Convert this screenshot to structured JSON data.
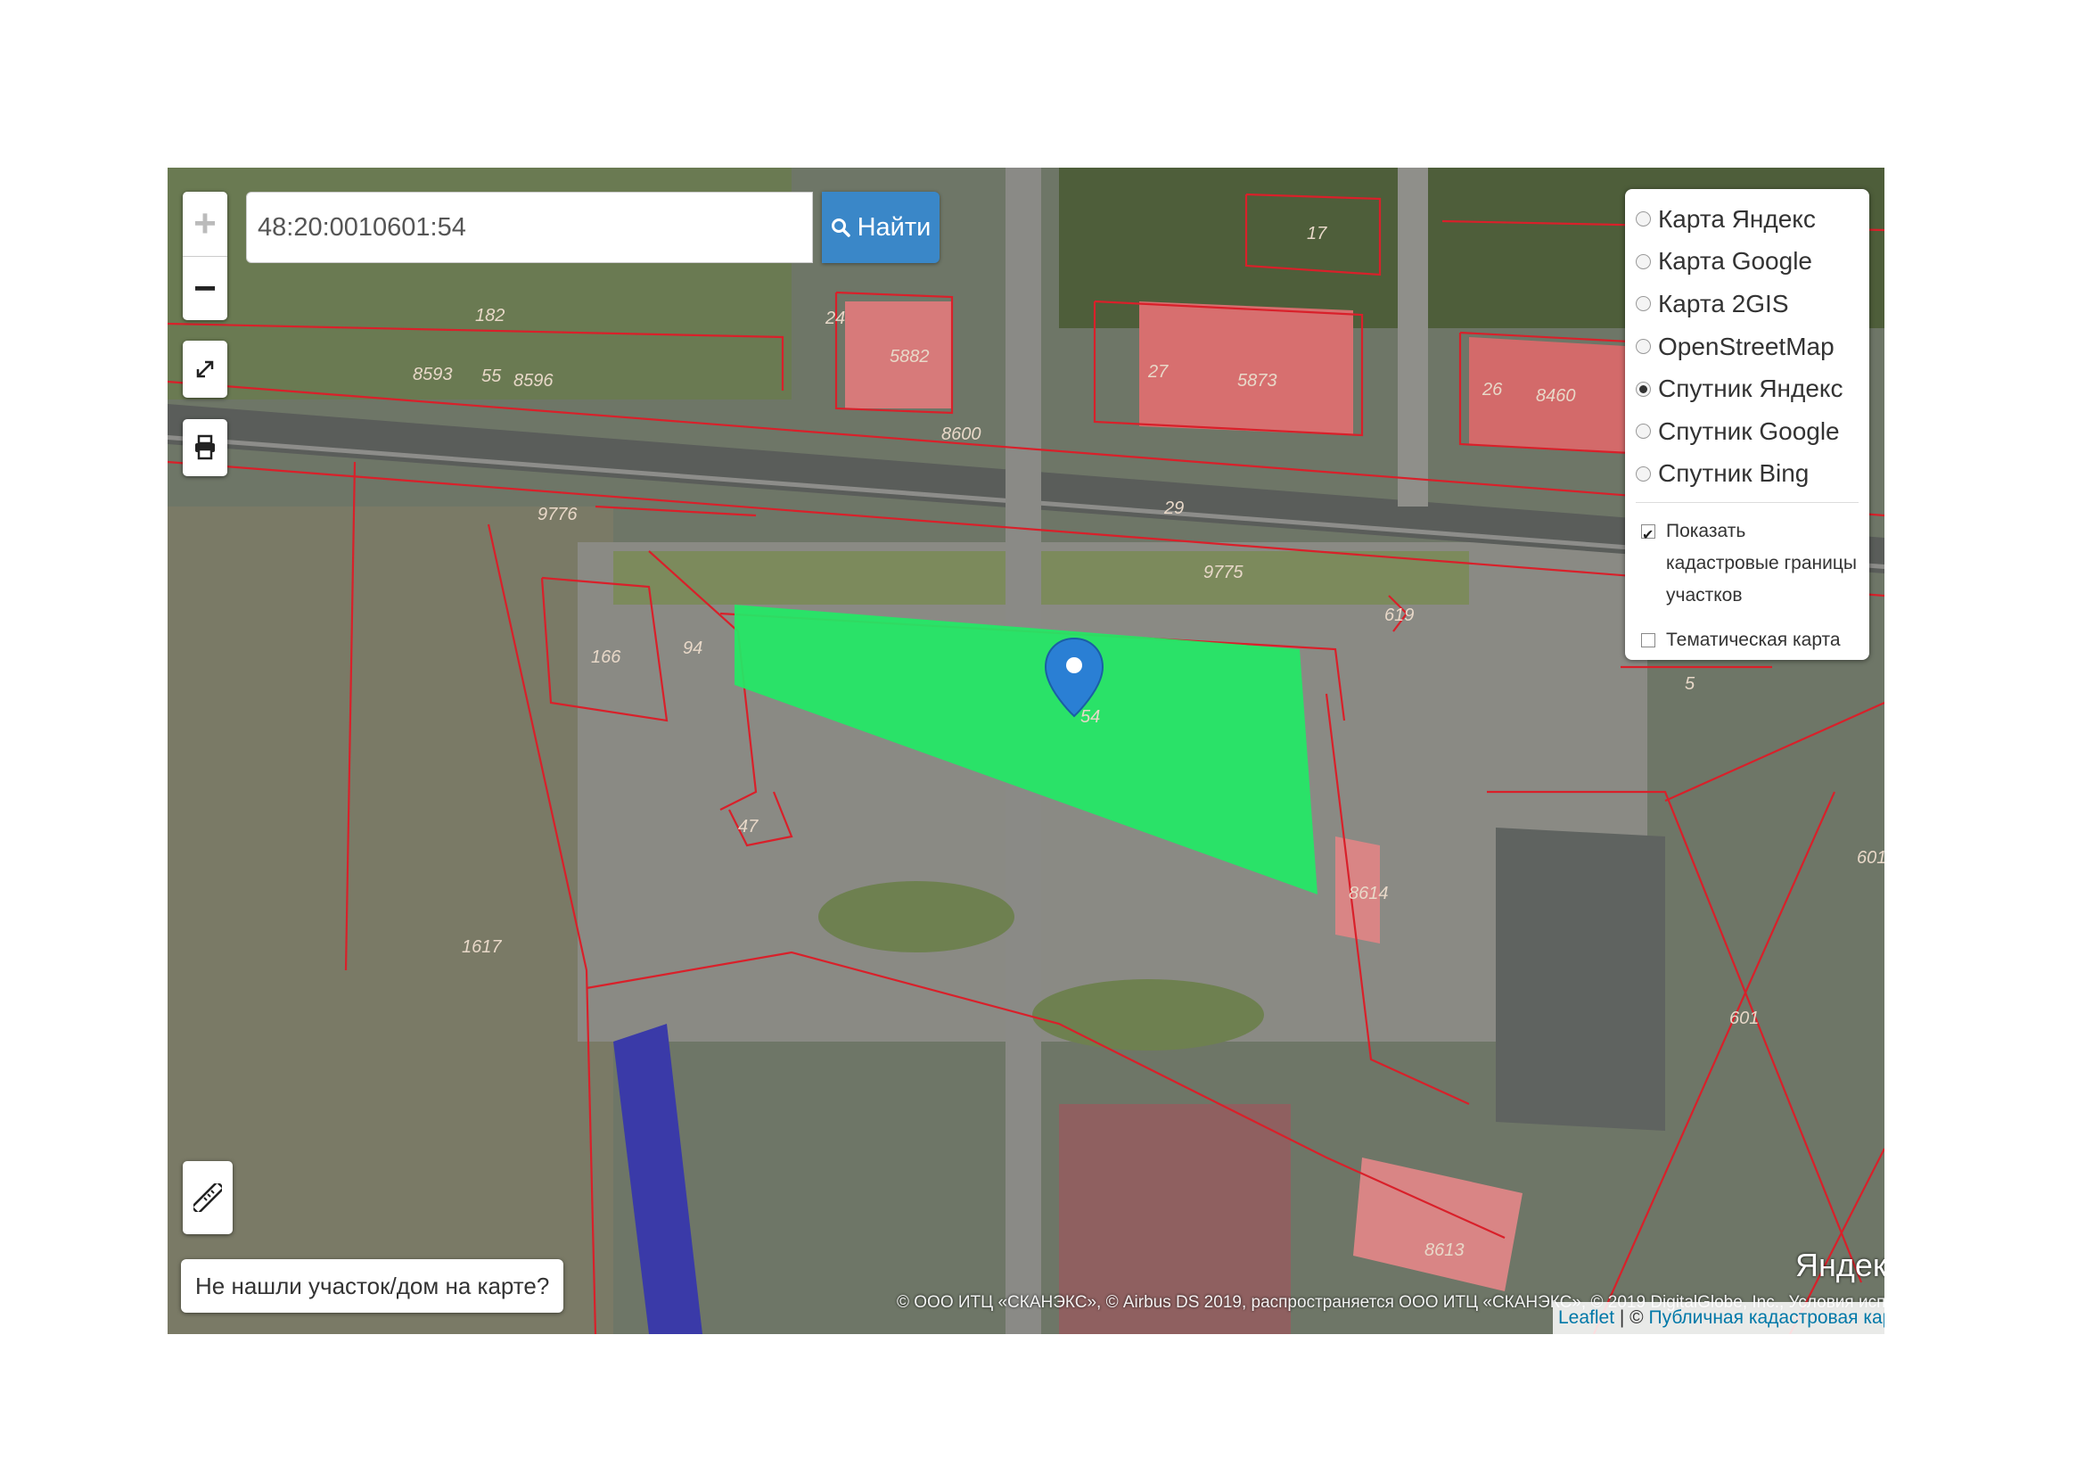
{
  "search": {
    "value": "48:20:0010601:54",
    "button_label": "Найти"
  },
  "zoom": {
    "in_label": "+",
    "out_label": "−"
  },
  "layers": {
    "base_maps": [
      {
        "label": "Карта Яндекс",
        "checked": false
      },
      {
        "label": "Карта Google",
        "checked": false
      },
      {
        "label": "Карта 2GIS",
        "checked": false
      },
      {
        "label": "OpenStreetMap",
        "checked": false
      },
      {
        "label": "Спутник Яндекс",
        "checked": true
      },
      {
        "label": "Спутник Google",
        "checked": false
      },
      {
        "label": "Спутник Bing",
        "checked": false
      }
    ],
    "overlays": [
      {
        "label": "Показать кадастровые границы участков",
        "checked": true
      },
      {
        "label": "Тематическая карта",
        "checked": false
      }
    ]
  },
  "not_found_label": "Не нашли участок/дом на карте?",
  "yandex_copyright": "© ООО ИТЦ «СКАНЭКС», © Airbus DS 2019, распространяется ООО ИТЦ «СКАНЭКС», © 2019 DigitalGlobe, Inc., Условия использования",
  "yandex_logo": "Яндекс",
  "attribution": {
    "leaflet": "Leaflet",
    "separator": " | © ",
    "cadastral": "Публичная кадастровая карта",
    "suffix": ", ©"
  },
  "parcel_labels": {
    "l17": "17",
    "l182": "182",
    "l24": "24",
    "l5882": "5882",
    "l27": "27",
    "l5873": "5873",
    "l26": "26",
    "l8460": "8460",
    "l8593": "8593",
    "l55": "55",
    "l8596": "8596",
    "l8600": "8600",
    "l9776": "9776",
    "l29": "29",
    "l9775": "9775",
    "l619": "619",
    "l166": "166",
    "l94": "94",
    "l54": "54",
    "l5": "5",
    "l8614": "8614",
    "l601a": "601",
    "l601b": "601",
    "l1617": "1617",
    "l8613": "8613",
    "l47": "47"
  },
  "colors": {
    "parcel_highlight": "#22e866",
    "boundary": "#d9202a",
    "marker": "#2a7fd4",
    "button": "#3a87c8"
  }
}
